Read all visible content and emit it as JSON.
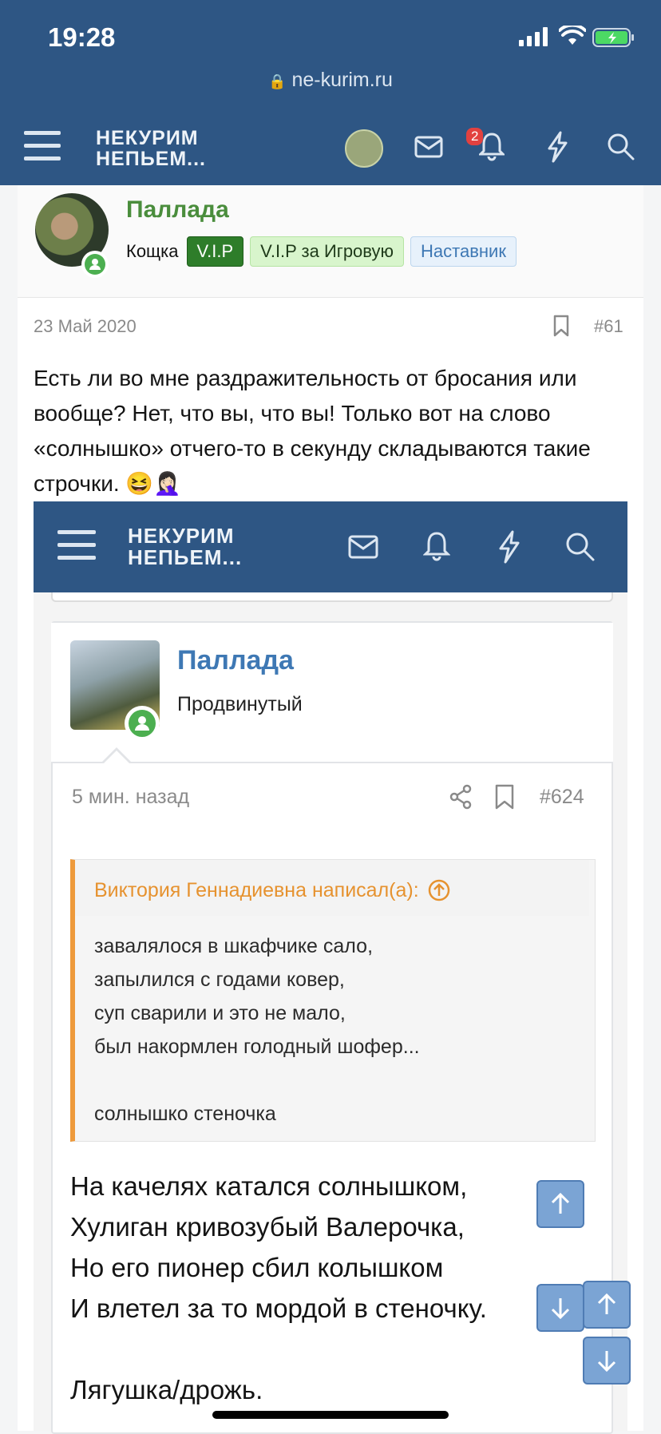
{
  "status_bar": {
    "time": "19:28"
  },
  "browser": {
    "url": "ne-kurim.ru"
  },
  "site": {
    "logo_line1": "НЕКУРИМ",
    "logo_line2": "НЕПЬЕМ...",
    "notifications_count": "2"
  },
  "author": {
    "name": "Паллада",
    "title": "Кощка",
    "badges": [
      "V.I.P",
      "V.I.P за Игровую",
      "Наставник"
    ],
    "name_color": "#4a8d3c"
  },
  "post": {
    "date": "23 Май 2020",
    "number": "#61",
    "text": "Есть ли во мне раздражительность от бросания или вообще? Нет, что вы, что вы! Только вот на слово «солнышко» отчего-то в секунду складываются такие строчки. 😆🤦🏻‍♀️"
  },
  "embedded": {
    "author_name": "Паллада",
    "author_rank": "Продвинутый",
    "time_ago": "5 мин. назад",
    "number": "#624",
    "quote_header": "Виктория Геннадиевна написал(а):",
    "quote_lines": [
      "завалялося в шкафчике сало,",
      "запылился с годами ковер,",
      "суп сварили и это не мало,",
      "был накормлен голодный шофер...",
      "",
      "солнышко стеночка"
    ],
    "poem_lines": [
      "На качелях катался солнышком,",
      "Хулиган кривозубый Валерочка,",
      "Но его пионер сбил колышком",
      "И влетел за то мордой в стеночку.",
      "",
      "Лягушка/дрожь."
    ]
  },
  "colors": {
    "header_bg": "#2e5684",
    "accent_link": "#3e78b4",
    "quote_accent": "#ee9a3b"
  }
}
